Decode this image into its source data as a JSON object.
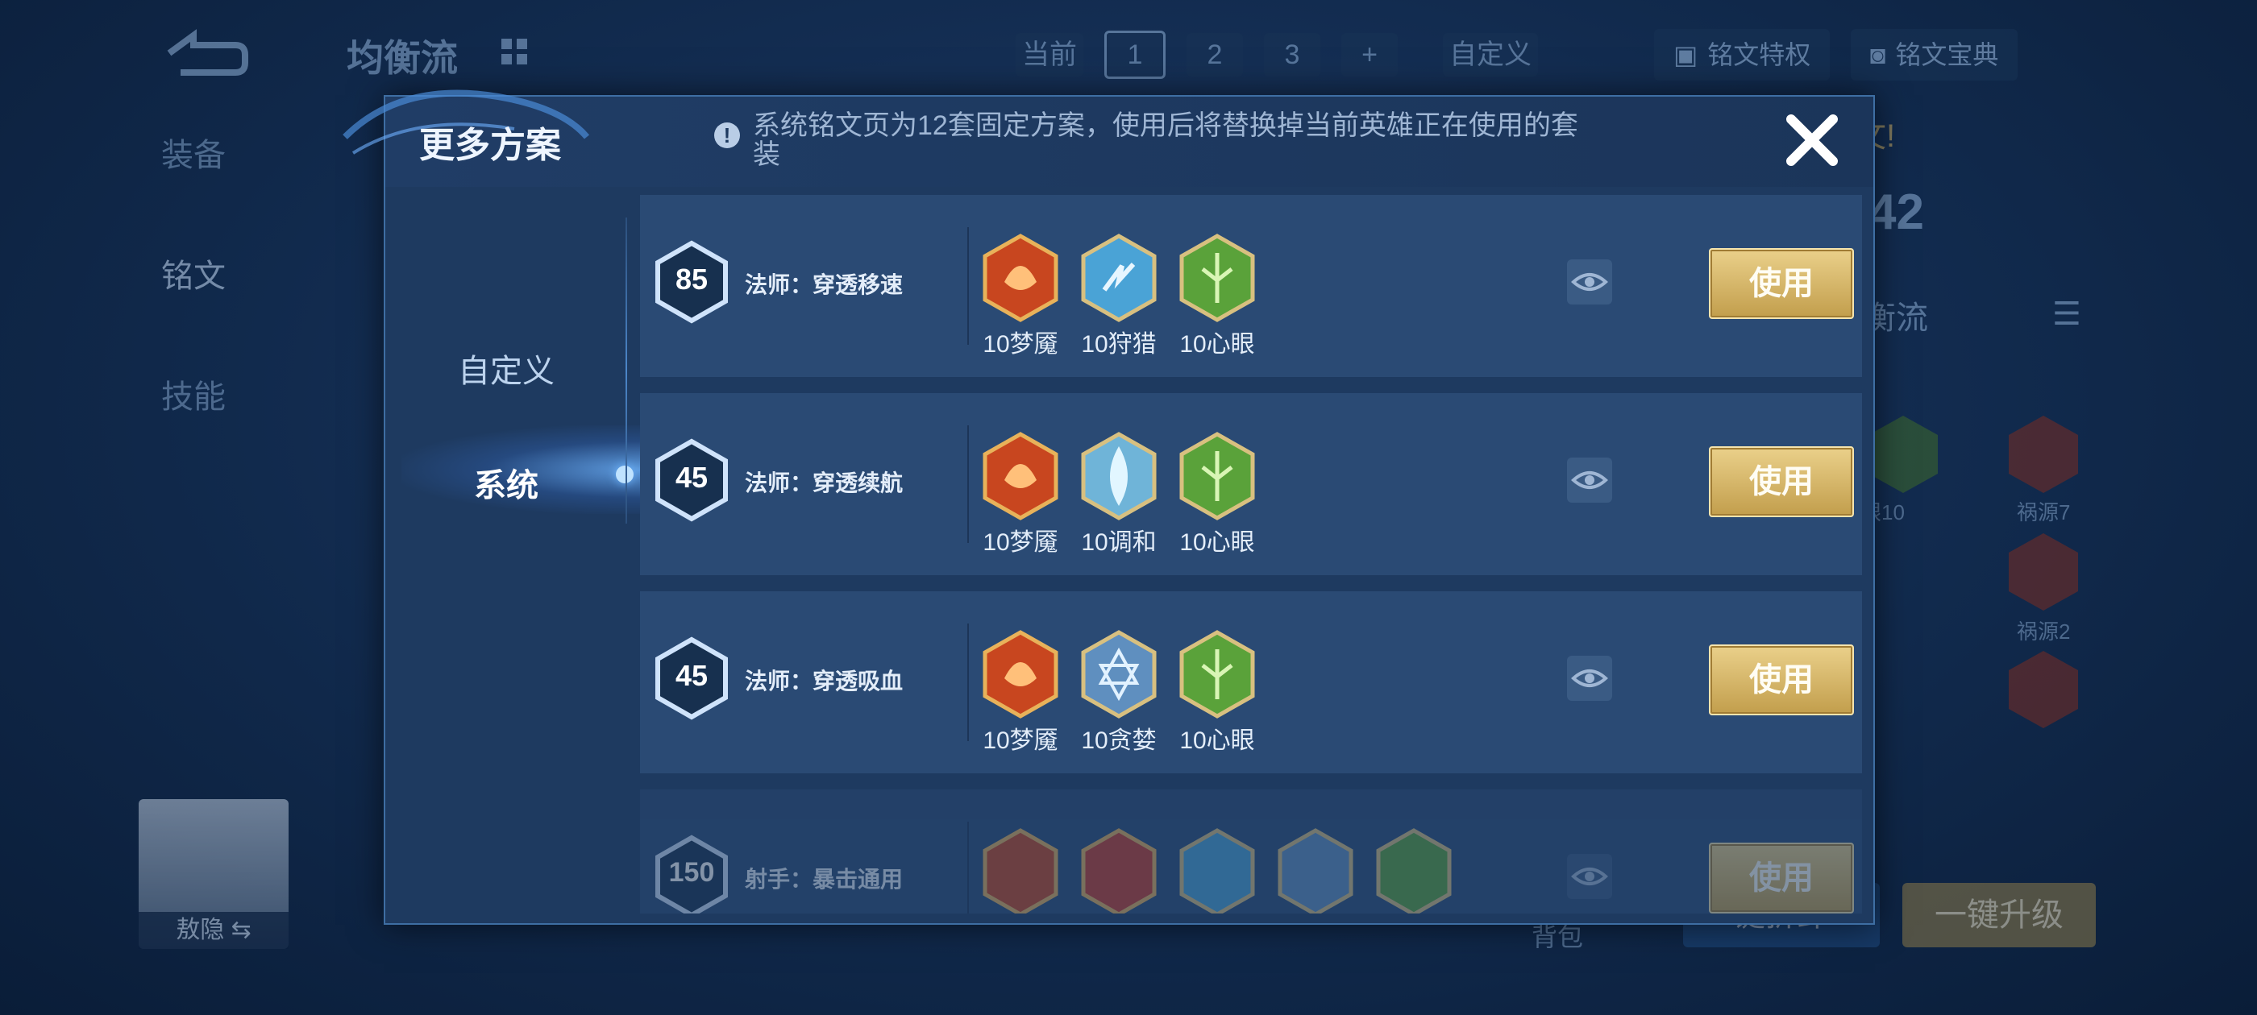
{
  "background": {
    "title": "均衡流",
    "pages_label": "当前",
    "pages": [
      "1",
      "2",
      "3",
      "+"
    ],
    "custom_label": "自定义",
    "rune_privilege": "铭文特权",
    "rune_guide": "铭文宝典",
    "side_nav": [
      "装备",
      "铭文",
      "技能"
    ],
    "hero_name": "敖隐",
    "bag_label": "背包",
    "right_level": "42",
    "right_label": "衡流",
    "notice_partial": "文!",
    "upgrade_button": "一键升级",
    "left_button_partial": "键拆卸",
    "right_runes": [
      "祸源7",
      "祸源2"
    ],
    "partial_rune_label": "眼10"
  },
  "modal": {
    "title": "更多方案",
    "info_text": "系统铭文页为12套固定方案，使用后将替换掉当前英雄正在使用的套装",
    "tabs": [
      "自定义",
      "系统"
    ],
    "active_tab": "系统",
    "rows": [
      {
        "level": "85",
        "name": "法师：穿透移速",
        "runes": [
          {
            "label": "10梦魇",
            "icon": "red-nightmare-icon"
          },
          {
            "label": "10狩猎",
            "icon": "blue-hunt-icon"
          },
          {
            "label": "10心眼",
            "icon": "green-insight-icon"
          }
        ],
        "use": "使用"
      },
      {
        "level": "45",
        "name": "法师：穿透续航",
        "runes": [
          {
            "label": "10梦魇",
            "icon": "red-nightmare-icon"
          },
          {
            "label": "10调和",
            "icon": "blue-harmony-icon"
          },
          {
            "label": "10心眼",
            "icon": "green-insight-icon"
          }
        ],
        "use": "使用"
      },
      {
        "level": "45",
        "name": "法师：穿透吸血",
        "runes": [
          {
            "label": "10梦魇",
            "icon": "red-nightmare-icon"
          },
          {
            "label": "10贪婪",
            "icon": "blue-greed-icon"
          },
          {
            "label": "10心眼",
            "icon": "green-insight-icon"
          }
        ],
        "use": "使用"
      },
      {
        "level": "150",
        "name": "射手：暴击通用",
        "runes": [],
        "use": "使用"
      }
    ]
  },
  "colors": {
    "accent": "#d7b86a",
    "panel": "#1e3a60",
    "row": "#2a4a74"
  }
}
